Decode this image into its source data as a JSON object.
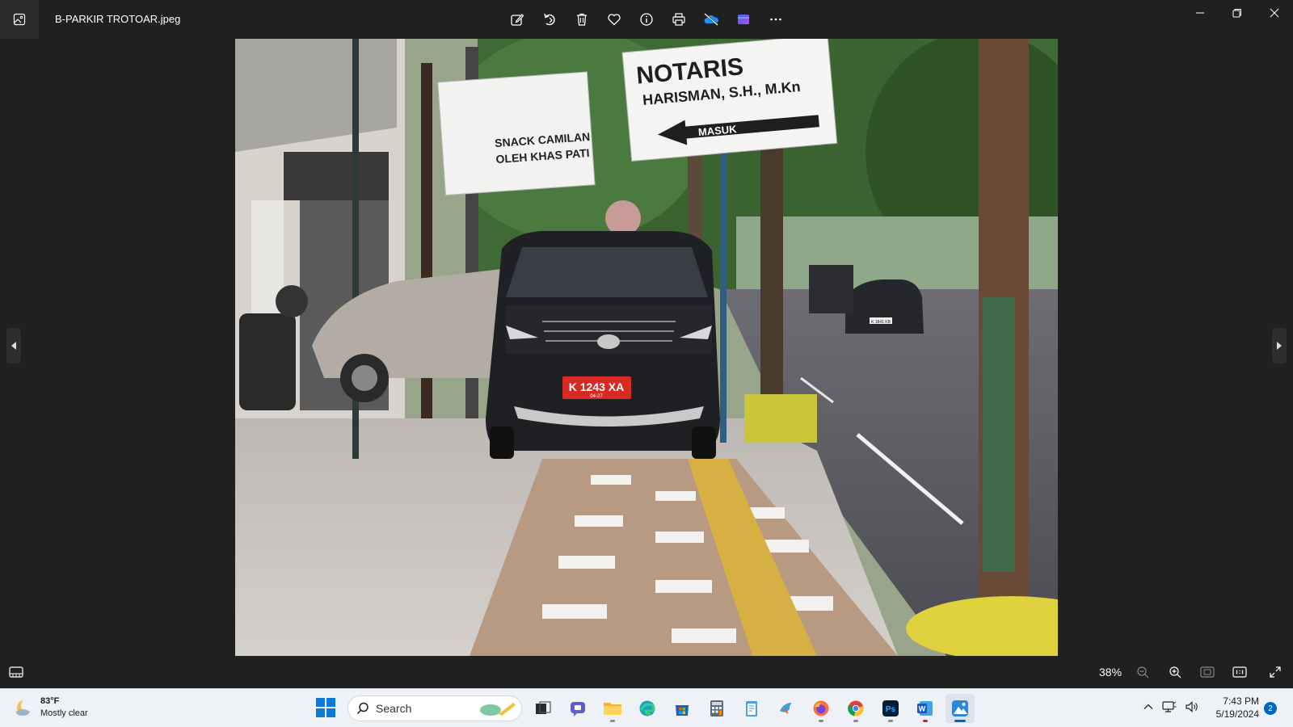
{
  "window": {
    "file_name": "B-PARKIR TROTOAR.jpeg"
  },
  "toolbar": {
    "icons": [
      "edit-icon",
      "rotate-icon",
      "delete-icon",
      "favorite-icon",
      "info-icon",
      "print-icon",
      "onedrive-icon",
      "clipchamp-icon",
      "more-icon"
    ]
  },
  "photo": {
    "signs": {
      "notaris_line1": "NOTARIS",
      "notaris_line2": "HARISMAN, S.H., M.Kn",
      "notaris_arrow": "MASUK",
      "snack_line1": "SNACK CAMILAN",
      "snack_line2": "OLEH KHAS PATI"
    },
    "plate_main": "K 1243 XA",
    "plate_sub": "04-27",
    "plate_car2": "K 1841 KB"
  },
  "bottombar": {
    "zoom": "38%"
  },
  "taskbar": {
    "weather_temp": "83°F",
    "weather_desc": "Mostly clear",
    "search_placeholder": "Search",
    "time": "7:43 PM",
    "date": "5/19/2024",
    "notification_count": "2"
  },
  "colors": {
    "accent": "#0067c0",
    "plate_red": "#d72a25"
  }
}
